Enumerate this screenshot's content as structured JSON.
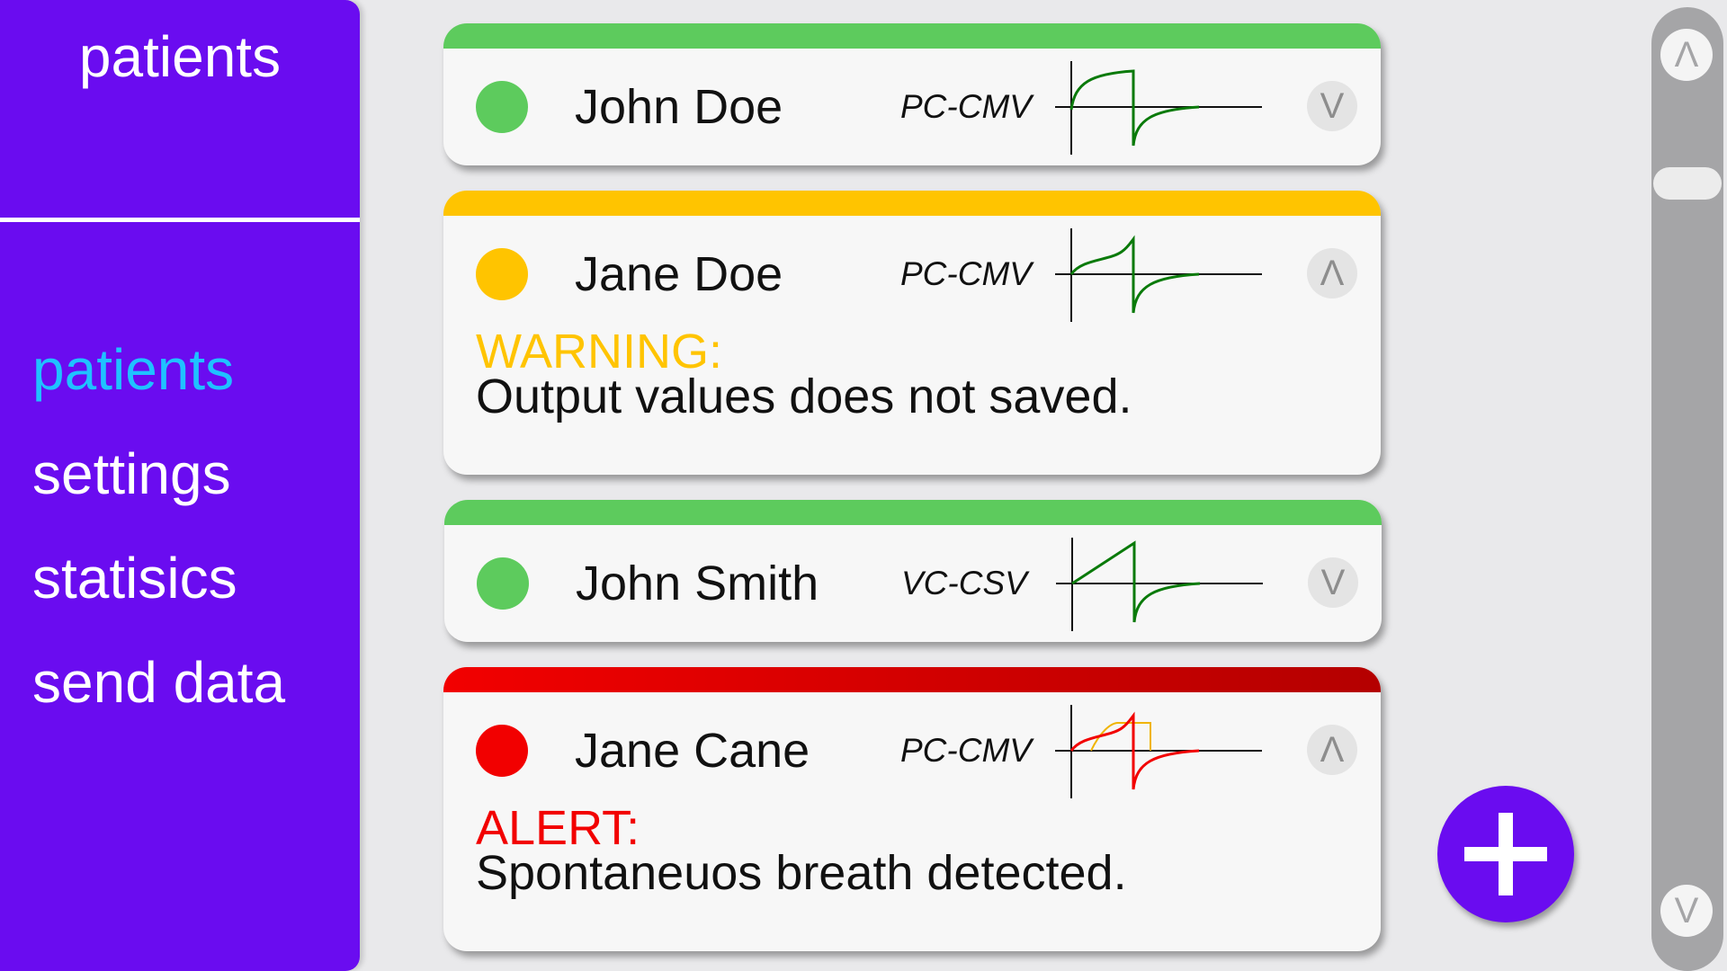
{
  "sidebar": {
    "title": "patients",
    "nav": [
      {
        "label": "patients",
        "active": true
      },
      {
        "label": "settings",
        "active": false
      },
      {
        "label": "statisics",
        "active": false
      },
      {
        "label": "send data",
        "active": false
      }
    ],
    "background_color": "#6a0cf0",
    "active_color": "#1fc2ff"
  },
  "patients": [
    {
      "name": "John Doe",
      "mode": "PC-CMV",
      "status": "green",
      "status_color": "#5dcb5d",
      "toggle": "V",
      "waveform": "pressure-control-ok"
    },
    {
      "name": "Jane Doe",
      "mode": "PC-CMV",
      "status": "yellow",
      "status_color": "#ffc400",
      "toggle": "Λ",
      "waveform": "pressure-control-warning",
      "message_label": "WARNING:",
      "message": "Output values does not saved.",
      "message_color": "#ffc400"
    },
    {
      "name": "John Smith",
      "mode": "VC-CSV",
      "status": "green",
      "status_color": "#5dcb5d",
      "toggle": "V",
      "waveform": "volume-control-ok"
    },
    {
      "name": "Jane Cane",
      "mode": "PC-CMV",
      "status": "red",
      "status_color": "#f20000",
      "toggle": "Λ",
      "waveform": "pressure-control-alert",
      "message_label": "ALERT:",
      "message": "Spontaneuos breath detected.",
      "message_color": "#f20000"
    }
  ],
  "fab": {
    "icon": "plus-icon",
    "color": "#6a0cf0"
  },
  "scrollbar": {
    "up_icon": "Λ",
    "down_icon": "V"
  }
}
